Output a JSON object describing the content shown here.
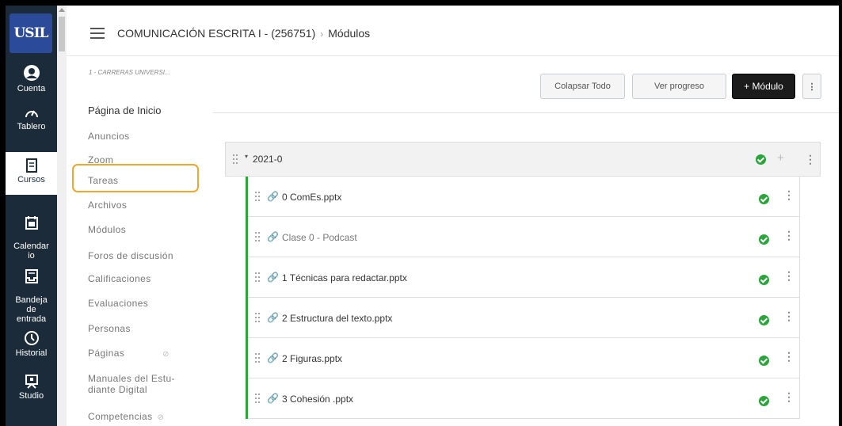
{
  "header": {
    "course": "COMUNICACIÓN ESCRITA I - (256751)",
    "separator": "›",
    "page": "Módulos"
  },
  "global_nav": {
    "logo_text": "USIL",
    "items": [
      {
        "label": "Cuenta",
        "icon": "account-icon"
      },
      {
        "label": "Tablero",
        "icon": "dashboard-icon"
      },
      {
        "label": "Cursos",
        "icon": "courses-icon"
      },
      {
        "label": "Calendar\nio",
        "icon": "calendar-icon"
      },
      {
        "label": "Bandeja\nde\nentrada",
        "icon": "inbox-icon"
      },
      {
        "label": "Historial",
        "icon": "history-icon"
      },
      {
        "label": "Studio",
        "icon": "studio-icon"
      }
    ]
  },
  "course_nav": {
    "subtitle": "1 - CARRERAS UNIVERSI...",
    "items": [
      {
        "label": "Página de Inicio"
      },
      {
        "label": "Anuncios"
      },
      {
        "label": "Zoom"
      },
      {
        "label": "Tareas"
      },
      {
        "label": "Archivos"
      },
      {
        "label": "Módulos"
      },
      {
        "label": "Foros de discusión"
      },
      {
        "label": "Calificaciones"
      },
      {
        "label": "Evaluaciones"
      },
      {
        "label": "Personas"
      },
      {
        "label": "Páginas"
      },
      {
        "label": "Manuales del Estu-"
      },
      {
        "label": "diante Digital"
      },
      {
        "label": "Competencias"
      }
    ]
  },
  "toolbar": {
    "collapse_all": "Colapsar Todo",
    "view_progress": "Ver progreso",
    "add_module": "+ Módulo",
    "more": "⋮"
  },
  "module": {
    "title": "2021-0",
    "items": [
      {
        "title": "0 ComEs.pptx",
        "muted": false
      },
      {
        "title": "Clase 0 - Podcast",
        "muted": true
      },
      {
        "title": "1 Técnicas para redactar.pptx",
        "muted": false
      },
      {
        "title": "2 Estructura del texto.pptx",
        "muted": false
      },
      {
        "title": "2 Figuras.pptx",
        "muted": false
      },
      {
        "title": "3 Cohesión .pptx",
        "muted": false
      }
    ]
  },
  "colors": {
    "nav_bg": "#1b2b3a",
    "highlight": "#f2a72c",
    "published": "#2aa53a"
  }
}
